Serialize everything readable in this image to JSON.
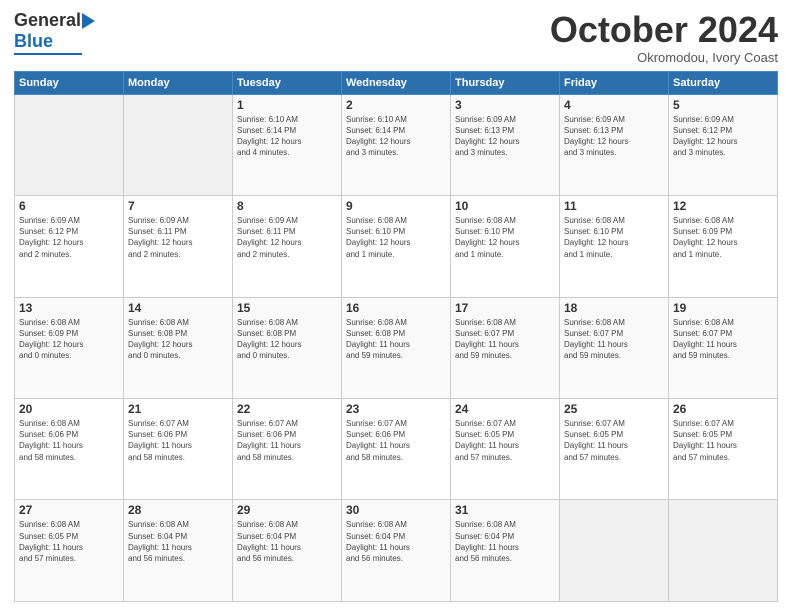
{
  "header": {
    "logo": {
      "general": "General",
      "blue": "Blue"
    },
    "title": "October 2024",
    "location": "Okromodou, Ivory Coast"
  },
  "weekdays": [
    "Sunday",
    "Monday",
    "Tuesday",
    "Wednesday",
    "Thursday",
    "Friday",
    "Saturday"
  ],
  "weeks": [
    [
      {
        "day": "",
        "info": ""
      },
      {
        "day": "",
        "info": ""
      },
      {
        "day": "1",
        "info": "Sunrise: 6:10 AM\nSunset: 6:14 PM\nDaylight: 12 hours\nand 4 minutes."
      },
      {
        "day": "2",
        "info": "Sunrise: 6:10 AM\nSunset: 6:14 PM\nDaylight: 12 hours\nand 3 minutes."
      },
      {
        "day": "3",
        "info": "Sunrise: 6:09 AM\nSunset: 6:13 PM\nDaylight: 12 hours\nand 3 minutes."
      },
      {
        "day": "4",
        "info": "Sunrise: 6:09 AM\nSunset: 6:13 PM\nDaylight: 12 hours\nand 3 minutes."
      },
      {
        "day": "5",
        "info": "Sunrise: 6:09 AM\nSunset: 6:12 PM\nDaylight: 12 hours\nand 3 minutes."
      }
    ],
    [
      {
        "day": "6",
        "info": "Sunrise: 6:09 AM\nSunset: 6:12 PM\nDaylight: 12 hours\nand 2 minutes."
      },
      {
        "day": "7",
        "info": "Sunrise: 6:09 AM\nSunset: 6:11 PM\nDaylight: 12 hours\nand 2 minutes."
      },
      {
        "day": "8",
        "info": "Sunrise: 6:09 AM\nSunset: 6:11 PM\nDaylight: 12 hours\nand 2 minutes."
      },
      {
        "day": "9",
        "info": "Sunrise: 6:08 AM\nSunset: 6:10 PM\nDaylight: 12 hours\nand 1 minute."
      },
      {
        "day": "10",
        "info": "Sunrise: 6:08 AM\nSunset: 6:10 PM\nDaylight: 12 hours\nand 1 minute."
      },
      {
        "day": "11",
        "info": "Sunrise: 6:08 AM\nSunset: 6:10 PM\nDaylight: 12 hours\nand 1 minute."
      },
      {
        "day": "12",
        "info": "Sunrise: 6:08 AM\nSunset: 6:09 PM\nDaylight: 12 hours\nand 1 minute."
      }
    ],
    [
      {
        "day": "13",
        "info": "Sunrise: 6:08 AM\nSunset: 6:09 PM\nDaylight: 12 hours\nand 0 minutes."
      },
      {
        "day": "14",
        "info": "Sunrise: 6:08 AM\nSunset: 6:08 PM\nDaylight: 12 hours\nand 0 minutes."
      },
      {
        "day": "15",
        "info": "Sunrise: 6:08 AM\nSunset: 6:08 PM\nDaylight: 12 hours\nand 0 minutes."
      },
      {
        "day": "16",
        "info": "Sunrise: 6:08 AM\nSunset: 6:08 PM\nDaylight: 11 hours\nand 59 minutes."
      },
      {
        "day": "17",
        "info": "Sunrise: 6:08 AM\nSunset: 6:07 PM\nDaylight: 11 hours\nand 59 minutes."
      },
      {
        "day": "18",
        "info": "Sunrise: 6:08 AM\nSunset: 6:07 PM\nDaylight: 11 hours\nand 59 minutes."
      },
      {
        "day": "19",
        "info": "Sunrise: 6:08 AM\nSunset: 6:07 PM\nDaylight: 11 hours\nand 59 minutes."
      }
    ],
    [
      {
        "day": "20",
        "info": "Sunrise: 6:08 AM\nSunset: 6:06 PM\nDaylight: 11 hours\nand 58 minutes."
      },
      {
        "day": "21",
        "info": "Sunrise: 6:07 AM\nSunset: 6:06 PM\nDaylight: 11 hours\nand 58 minutes."
      },
      {
        "day": "22",
        "info": "Sunrise: 6:07 AM\nSunset: 6:06 PM\nDaylight: 11 hours\nand 58 minutes."
      },
      {
        "day": "23",
        "info": "Sunrise: 6:07 AM\nSunset: 6:06 PM\nDaylight: 11 hours\nand 58 minutes."
      },
      {
        "day": "24",
        "info": "Sunrise: 6:07 AM\nSunset: 6:05 PM\nDaylight: 11 hours\nand 57 minutes."
      },
      {
        "day": "25",
        "info": "Sunrise: 6:07 AM\nSunset: 6:05 PM\nDaylight: 11 hours\nand 57 minutes."
      },
      {
        "day": "26",
        "info": "Sunrise: 6:07 AM\nSunset: 6:05 PM\nDaylight: 11 hours\nand 57 minutes."
      }
    ],
    [
      {
        "day": "27",
        "info": "Sunrise: 6:08 AM\nSunset: 6:05 PM\nDaylight: 11 hours\nand 57 minutes."
      },
      {
        "day": "28",
        "info": "Sunrise: 6:08 AM\nSunset: 6:04 PM\nDaylight: 11 hours\nand 56 minutes."
      },
      {
        "day": "29",
        "info": "Sunrise: 6:08 AM\nSunset: 6:04 PM\nDaylight: 11 hours\nand 56 minutes."
      },
      {
        "day": "30",
        "info": "Sunrise: 6:08 AM\nSunset: 6:04 PM\nDaylight: 11 hours\nand 56 minutes."
      },
      {
        "day": "31",
        "info": "Sunrise: 6:08 AM\nSunset: 6:04 PM\nDaylight: 11 hours\nand 56 minutes."
      },
      {
        "day": "",
        "info": ""
      },
      {
        "day": "",
        "info": ""
      }
    ]
  ]
}
